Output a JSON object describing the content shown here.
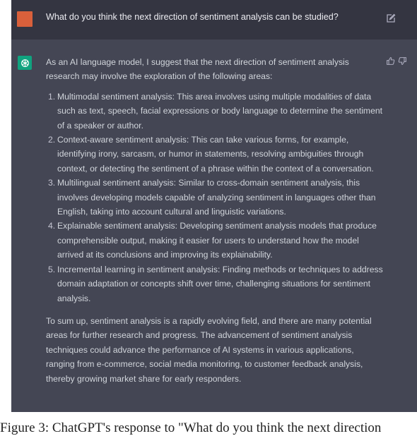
{
  "user_message": {
    "text": "What do you think the next direction of sentiment analysis can be studied?"
  },
  "assistant_message": {
    "intro": "As an AI language model, I suggest that the next direction of sentiment analysis research may involve the exploration of the following areas:",
    "items": [
      {
        "number": "1.",
        "text": "Multimodal sentiment analysis: This area involves using multiple modalities of data such as text, speech, facial expressions or body language to determine the sentiment of a speaker or author."
      },
      {
        "number": "2.",
        "text": "Context-aware sentiment analysis: This can take various forms, for example, identifying irony, sarcasm, or humor in statements, resolving ambiguities through context, or detecting the sentiment of a phrase within the context of a conversation."
      },
      {
        "number": "3.",
        "text": "Multilingual sentiment analysis: Similar to cross-domain sentiment analysis, this involves developing models capable of analyzing sentiment in languages other than English, taking into account cultural and linguistic variations."
      },
      {
        "number": "4.",
        "text": "Explainable sentiment analysis: Developing sentiment analysis models that produce comprehensible output, making it easier for users to understand how the model arrived at its conclusions and improving its explainability."
      },
      {
        "number": "5.",
        "text": "Incremental learning in sentiment analysis: Finding methods or techniques to address domain adaptation or concepts shift over time, challenging situations for sentiment analysis."
      }
    ],
    "summary": "To sum up, sentiment analysis is a rapidly evolving field, and there are many potential areas for further research and progress. The advancement of sentiment analysis techniques could advance the performance of AI systems in various applications, ranging from e-commerce, social media monitoring, to customer feedback analysis, thereby growing market share for early responders."
  },
  "icons": {
    "user_avatar": "user-avatar",
    "bot_avatar": "openai-logo-icon",
    "edit": "edit-icon",
    "thumbs_up": "thumbs-up-icon",
    "thumbs_down": "thumbs-down-icon"
  },
  "colors": {
    "user_row_bg": "#343541",
    "assistant_row_bg": "#444654",
    "user_avatar": "#d9603b",
    "bot_avatar": "#10a37f"
  },
  "caption": "Figure 3: ChatGPT's response to \"What do you think the next direction"
}
